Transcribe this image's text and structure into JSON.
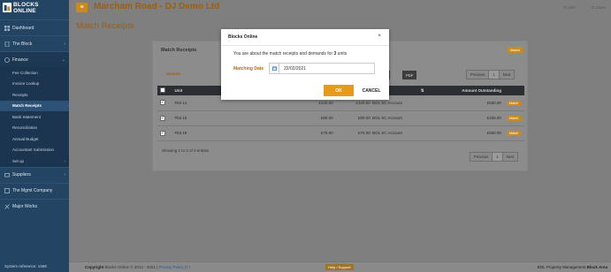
{
  "brand": {
    "line1": "BLOCKS",
    "line2": "ONLINE"
  },
  "topbar": {
    "site_title": "Marcham Road - DJ Demo Ltd",
    "user_label": "User",
    "close_label": "Close"
  },
  "sidebar": {
    "items": [
      {
        "label": "Dashboard",
        "icon": "dashboard-icon"
      },
      {
        "label": "The Block",
        "icon": "building-icon"
      },
      {
        "label": "Finance",
        "icon": "finance-icon"
      },
      {
        "label": "Suppliers",
        "icon": "suppliers-icon"
      },
      {
        "label": "The Mgmt Company",
        "icon": "company-icon"
      },
      {
        "label": "Major Works",
        "icon": "works-icon"
      }
    ],
    "finance_sub": [
      "Fee Collection",
      "Invoice Lookup",
      "Receipts",
      "Match Receipts",
      "Bank Statement",
      "Reconciliation",
      "Annual Budget",
      "Accountant Submission",
      "Set up"
    ],
    "system_reference": "System reference: 1468"
  },
  "page": {
    "title": "Match Receipts"
  },
  "panel": {
    "title": "Match Receipts",
    "match_button": "Match",
    "search_label": "Search:",
    "export": {
      "excel": "Excel",
      "pdf": "PDF"
    },
    "pager": {
      "previous": "Previous",
      "page": "1",
      "next": "Next"
    },
    "columns": {
      "unit": "Unit",
      "sort_arrow": "⇅",
      "amount_outstanding": "Amount Outstanding"
    },
    "rows": [
      {
        "unit": "Flat 14",
        "demand": "£120.00",
        "receipt": "£120.00",
        "account": "BOL SC Account",
        "outstanding": "£550.00",
        "action": "Match"
      },
      {
        "unit": "Flat 15",
        "demand": "£80.00",
        "receipt": "£80.00",
        "account": "BOL SC Account",
        "outstanding": "£450.00",
        "action": "Match"
      },
      {
        "unit": "Flat 19",
        "demand": "£75.00",
        "receipt": "£75.00",
        "account": "BOL SC Account",
        "outstanding": "£550.00",
        "action": "Match"
      }
    ],
    "showing": "Showing 1 to 3 of 3 entries"
  },
  "footer": {
    "copyright_prefix": "Copyright",
    "copyright": "Blocks Online © 2013 - 2021",
    "privacy": "Privacy Policy",
    "help": "Help / Support",
    "company": "BOL Property Management",
    "area": "Block Area"
  },
  "modal": {
    "title": "Blocks Online",
    "close": "×",
    "message_before": "You are about the match receipts and demands for ",
    "unit_count": "3",
    "message_after": " units",
    "date_label": "Matching Date",
    "date_value": "22/02/2021",
    "ok": "OK",
    "cancel": "CANCEL"
  },
  "colors": {
    "accent": "#e69a1a",
    "sidebar": "#234563",
    "title": "#9c5f12"
  }
}
